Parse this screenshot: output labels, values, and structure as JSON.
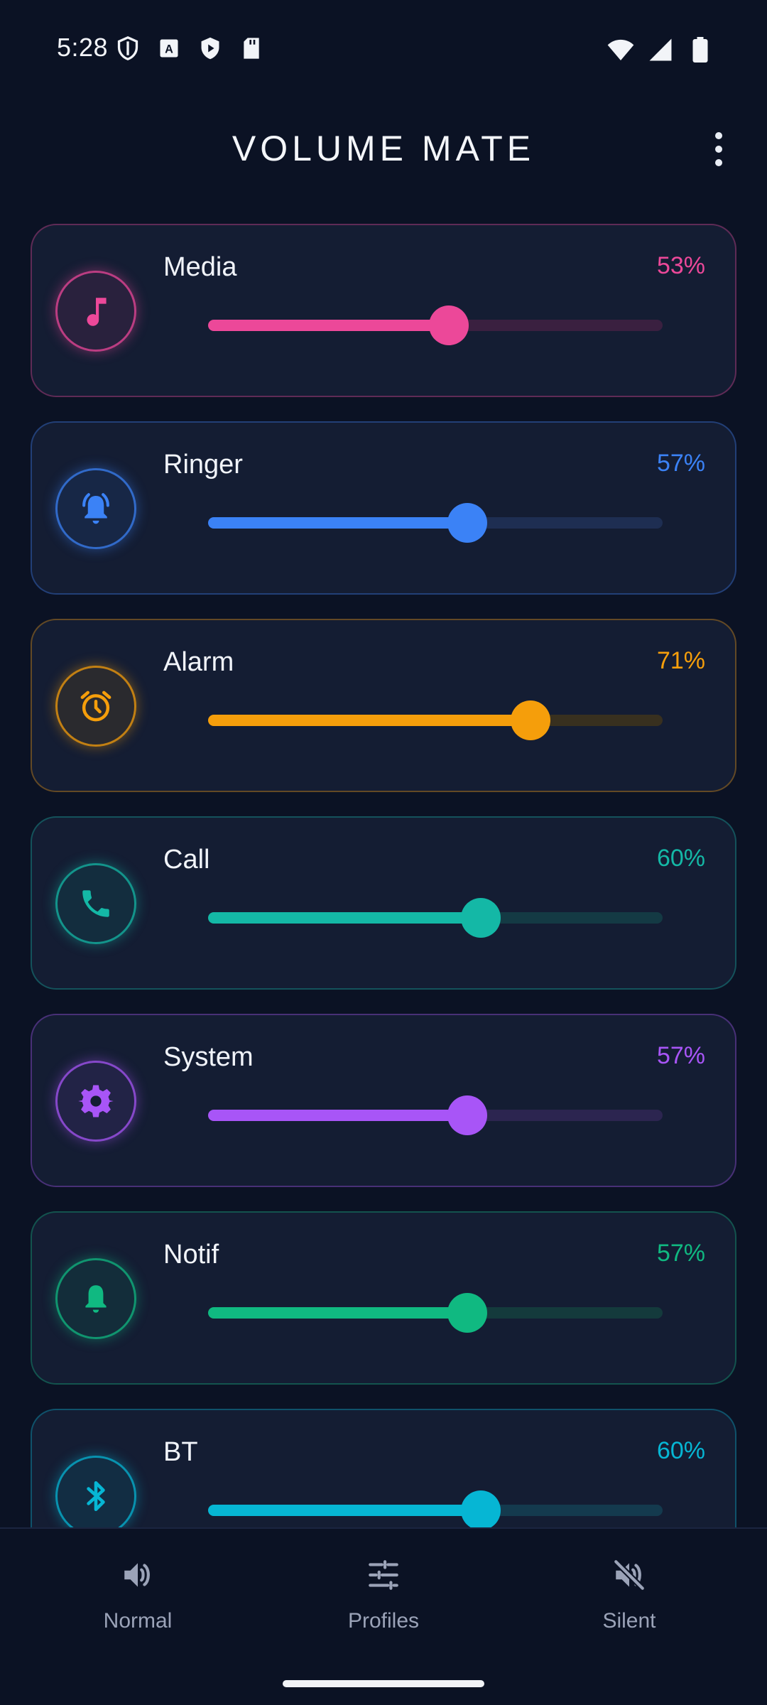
{
  "status_bar": {
    "time": "5:28"
  },
  "header": {
    "title": "VOLUME MATE"
  },
  "channels": [
    {
      "label": "Media",
      "value_text": "53%",
      "level": 0.53,
      "color": "#ec4899",
      "track": "#3a2040",
      "icon": "music-note-icon"
    },
    {
      "label": "Ringer",
      "value_text": "57%",
      "level": 0.57,
      "color": "#3b82f6",
      "track": "#1e2e52",
      "icon": "bell-ringing-icon"
    },
    {
      "label": "Alarm",
      "value_text": "71%",
      "level": 0.71,
      "color": "#f59e0b",
      "track": "#38301f",
      "icon": "alarm-clock-icon"
    },
    {
      "label": "Call",
      "value_text": "60%",
      "level": 0.6,
      "color": "#14b8a6",
      "track": "#143a44",
      "icon": "phone-icon"
    },
    {
      "label": "System",
      "value_text": "57%",
      "level": 0.57,
      "color": "#a855f7",
      "track": "#2c2550",
      "icon": "gear-icon"
    },
    {
      "label": "Notif",
      "value_text": "57%",
      "level": 0.57,
      "color": "#10b981",
      "track": "#143a3c",
      "icon": "bell-icon"
    },
    {
      "label": "BT",
      "value_text": "60%",
      "level": 0.6,
      "color": "#06b6d4",
      "track": "#143a4e",
      "icon": "bluetooth-icon"
    }
  ],
  "bottom_nav": {
    "items": [
      {
        "label": "Normal",
        "icon": "volume-up-icon"
      },
      {
        "label": "Profiles",
        "icon": "sliders-icon"
      },
      {
        "label": "Silent",
        "icon": "volume-off-icon"
      }
    ]
  }
}
